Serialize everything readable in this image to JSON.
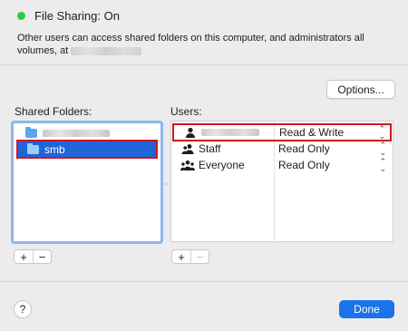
{
  "status": {
    "title": "File Sharing: On",
    "dot_color": "#2fc94a"
  },
  "description": {
    "text": "Other users can access shared folders on this computer, and administrators all volumes, at"
  },
  "options_button": {
    "label": "Options..."
  },
  "shared_folders": {
    "label": "Shared Folders:",
    "items": [
      {
        "name": "",
        "redacted": true,
        "selected": false
      },
      {
        "name": "smb",
        "redacted": false,
        "selected": true
      }
    ]
  },
  "users": {
    "label": "Users:",
    "rows": [
      {
        "name": "",
        "redacted": true,
        "icon": "single-user-icon",
        "permission": "Read & Write"
      },
      {
        "name": "Staff",
        "redacted": false,
        "icon": "group-icon",
        "permission": "Read Only"
      },
      {
        "name": "Everyone",
        "redacted": false,
        "icon": "everyone-icon",
        "permission": "Read Only"
      }
    ]
  },
  "buttons": {
    "add": "+",
    "remove": "−",
    "help": "?",
    "done": "Done"
  },
  "colors": {
    "accent": "#1a73e8",
    "selection": "#1e65d8",
    "highlight_border": "#d0151f"
  }
}
